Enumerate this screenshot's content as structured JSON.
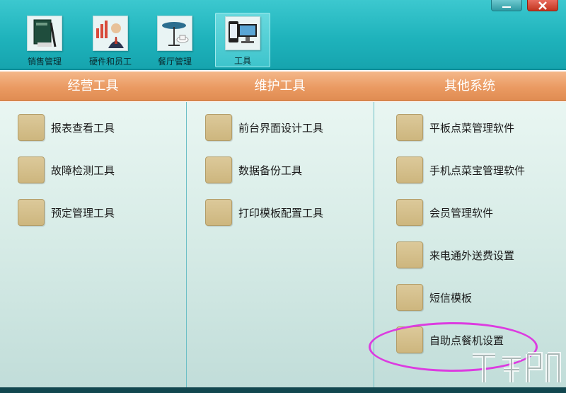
{
  "nav": {
    "items": [
      {
        "label": "销售管理",
        "icon": "ledger-book-icon"
      },
      {
        "label": "硬件和员工",
        "icon": "staff-chart-icon"
      },
      {
        "label": "餐厅管理",
        "icon": "cafe-table-icon"
      },
      {
        "label": "工具",
        "icon": "devices-icon"
      }
    ],
    "active_index": 3
  },
  "window": {
    "minimize_icon": "minimize-icon",
    "close_icon": "close-icon"
  },
  "sections": [
    {
      "title": "经营工具",
      "items": [
        "报表查看工具",
        "故障检测工具",
        "预定管理工具"
      ]
    },
    {
      "title": "维护工具",
      "items": [
        "前台界面设计工具",
        "数据备份工具",
        "打印模板配置工具"
      ]
    },
    {
      "title": "其他系统",
      "items": [
        "平板点菜管理软件",
        "手机点菜宝管理软件",
        "会员管理软件",
        "来电通外送费设置",
        "短信模板",
        "自助点餐机设置"
      ]
    }
  ],
  "colors": {
    "toolbar": "#1fb3bc",
    "header_band": "#ea9a62",
    "tool_swatch": "#d4c08b",
    "highlight": "#dc3ce0"
  }
}
